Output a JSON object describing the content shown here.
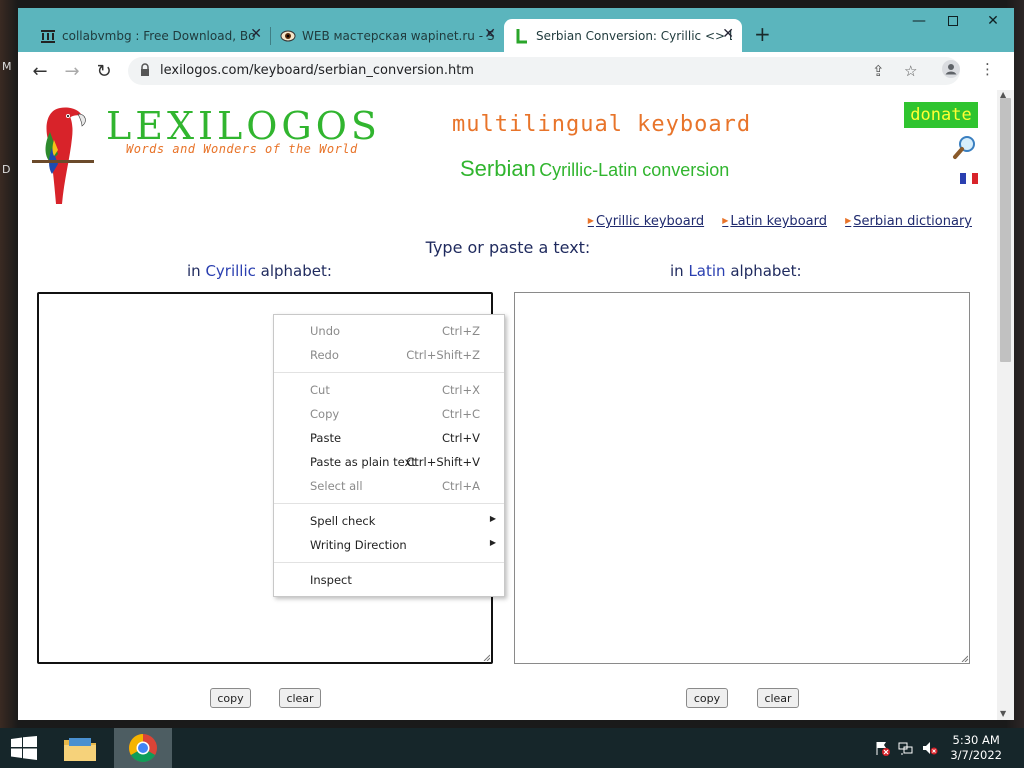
{
  "desktop": {
    "edge_labels": [
      "M",
      "D"
    ]
  },
  "browser": {
    "tabs": [
      {
        "title": "collabvmbg : Free Download, Bo",
        "icon": "library-icon",
        "active": false
      },
      {
        "title": "WEB мастерская wapinet.ru - So",
        "icon": "eye-icon",
        "active": false
      },
      {
        "title": "Serbian Conversion: Cyrillic <> L",
        "icon": "lexilogos-l-icon",
        "active": true
      }
    ],
    "url": "lexilogos.com/keyboard/serbian_conversion.htm"
  },
  "page": {
    "logo_text": "LEXILOGOS",
    "logo_tagline": "Words and Wonders of the World",
    "header_title": "multilingual keyboard",
    "subtitle_main": "Serbian",
    "subtitle_rest": "Cyrillic-Latin conversion",
    "donate_label": "donate",
    "links": [
      "Cyrillic keyboard",
      "Latin keyboard",
      "Serbian dictionary"
    ],
    "prompt": "Type or paste a text:",
    "left_head": {
      "pre": "in ",
      "hl": "Cyrillic",
      "post": " alphabet:"
    },
    "right_head": {
      "pre": "in ",
      "hl": "Latin",
      "post": " alphabet:"
    },
    "buttons": {
      "copy": "copy",
      "clear": "clear"
    }
  },
  "context_menu": {
    "items": [
      {
        "label": "Undo",
        "shortcut": "Ctrl+Z",
        "enabled": false
      },
      {
        "label": "Redo",
        "shortcut": "Ctrl+Shift+Z",
        "enabled": false
      },
      {
        "label": "Cut",
        "shortcut": "Ctrl+X",
        "enabled": false
      },
      {
        "label": "Copy",
        "shortcut": "Ctrl+C",
        "enabled": false
      },
      {
        "label": "Paste",
        "shortcut": "Ctrl+V",
        "enabled": true
      },
      {
        "label": "Paste as plain text",
        "shortcut": "Ctrl+Shift+V",
        "enabled": true
      },
      {
        "label": "Select all",
        "shortcut": "Ctrl+A",
        "enabled": false
      },
      {
        "label": "Spell check",
        "shortcut": "",
        "enabled": true,
        "submenu": true
      },
      {
        "label": "Writing Direction",
        "shortcut": "",
        "enabled": true,
        "submenu": true
      },
      {
        "label": "Inspect",
        "shortcut": "",
        "enabled": true
      }
    ]
  },
  "taskbar": {
    "time": "5:30 AM",
    "date": "3/7/2022"
  },
  "colors": {
    "frame": "#5bb5bd",
    "logo_green": "#31b52f",
    "logo_orange": "#e8742a",
    "link_navy": "#1f2a6e",
    "taskbar": "#16262a"
  }
}
